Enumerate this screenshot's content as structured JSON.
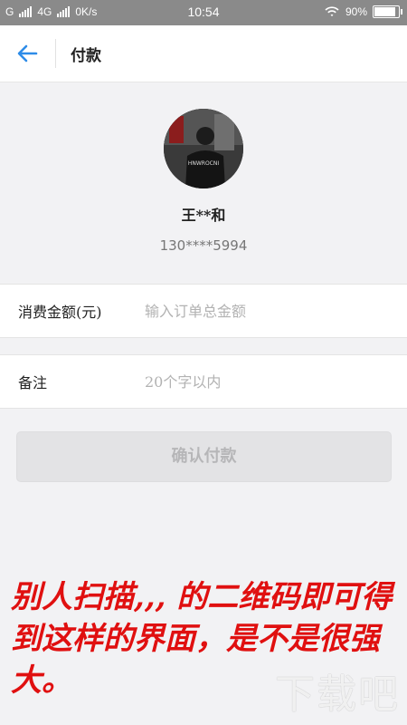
{
  "status_bar": {
    "carrier": "G",
    "network": "4G",
    "speed": "0K/s",
    "time": "10:54",
    "battery": "90%",
    "battery_level": 0.9
  },
  "header": {
    "title": "付款",
    "back_icon": "arrow-left-icon",
    "accent_color": "#2e8ce8"
  },
  "profile": {
    "avatar_caption": "HNWROCNI",
    "name": "王**和",
    "phone": "130****5994"
  },
  "form": {
    "amount": {
      "label": "消费金额(元)",
      "placeholder": "输入订单总金额",
      "value": ""
    },
    "note": {
      "label": "备注",
      "placeholder": "20个字以内",
      "value": ""
    }
  },
  "confirm_button": {
    "label": "确认付款"
  },
  "annotation": {
    "text": "别人扫描,,, 的二维码即可得到这样的界面，是不是很强大。",
    "color": "#e01010"
  },
  "watermark": {
    "text": "下载吧"
  }
}
